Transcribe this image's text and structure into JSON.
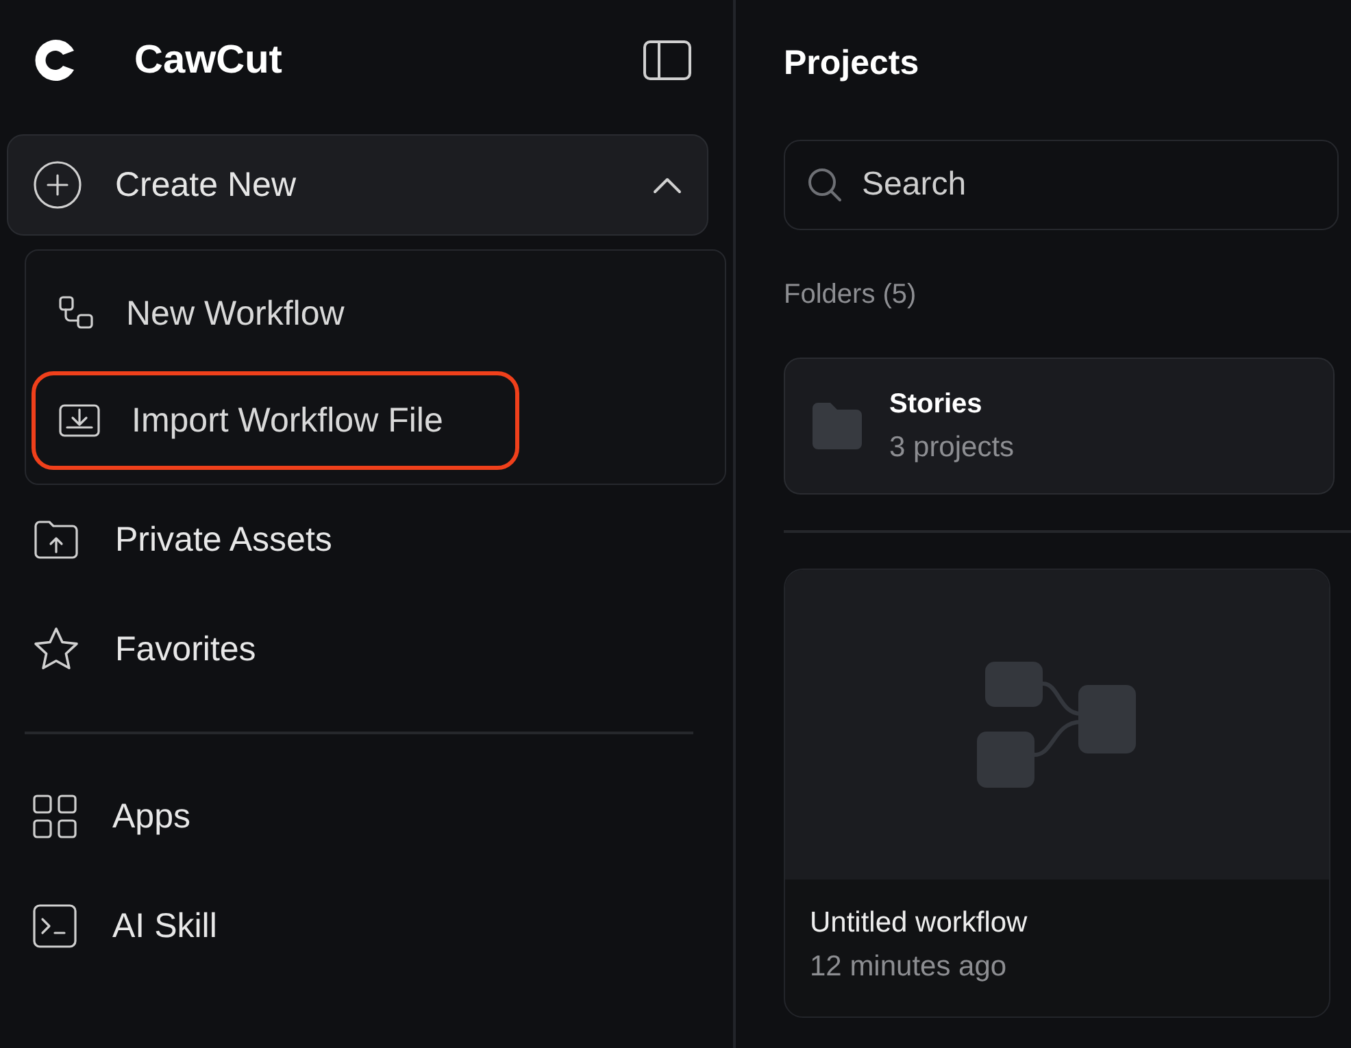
{
  "sidebar": {
    "brand": "CawCut",
    "create_button": {
      "label": "Create New",
      "expanded": true
    },
    "create_menu": [
      {
        "label": "New Workflow",
        "kind": "workflow",
        "highlighted": false
      },
      {
        "label": "Import Workflow File",
        "kind": "import",
        "highlighted": true
      }
    ],
    "items": [
      {
        "label": "Private Assets",
        "kind": "assets"
      },
      {
        "label": "Favorites",
        "kind": "star"
      }
    ],
    "items_2": [
      {
        "label": "Apps",
        "kind": "apps"
      },
      {
        "label": "AI Skill",
        "kind": "terminal"
      }
    ]
  },
  "main": {
    "title": "Projects",
    "search": {
      "placeholder": "Search"
    },
    "folders_heading": "Folders (5)",
    "folders": [
      {
        "name": "Stories",
        "count": "3 projects"
      }
    ],
    "workflows": [
      {
        "title": "Untitled workflow",
        "time": "12 minutes ago"
      }
    ]
  }
}
